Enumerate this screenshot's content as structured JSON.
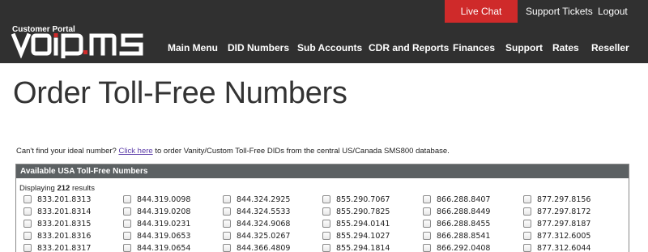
{
  "header": {
    "portal_label": "Customer Portal",
    "brand": "voip.ms",
    "live_chat": "Live Chat",
    "support_tickets": "Support Tickets",
    "logout": "Logout",
    "nav": [
      "Main Menu",
      "DID Numbers",
      "Sub Accounts",
      "CDR and Reports",
      "Finances",
      "Support",
      "Rates",
      "Reseller"
    ],
    "accent_color": "#cf2a2a"
  },
  "page": {
    "title": "Order Toll-Free Numbers",
    "help_prefix": "Can't find your ideal number? ",
    "help_link": "Click here",
    "help_suffix": " to order Vanity/Custom Toll-Free DIDs from the central US/Canada SMS800 database."
  },
  "panel": {
    "header": "Available USA Toll-Free Numbers",
    "display_prefix": "Displaying ",
    "display_count": "212",
    "display_suffix": " results",
    "rows": [
      [
        "833.201.8313",
        "844.319.0098",
        "844.324.2925",
        "855.290.7067",
        "866.288.8407",
        "877.297.8156"
      ],
      [
        "833.201.8314",
        "844.319.0208",
        "844.324.5533",
        "855.290.7825",
        "866.288.8449",
        "877.297.8172"
      ],
      [
        "833.201.8315",
        "844.319.0231",
        "844.324.9068",
        "855.294.0141",
        "866.288.8455",
        "877.297.8187"
      ],
      [
        "833.201.8316",
        "844.319.0653",
        "844.325.0267",
        "855.294.1027",
        "866.288.8541",
        "877.312.6005"
      ],
      [
        "833.201.8317",
        "844.319.0654",
        "844.366.4809",
        "855.294.1814",
        "866.292.0408",
        "877.312.6044"
      ]
    ]
  }
}
